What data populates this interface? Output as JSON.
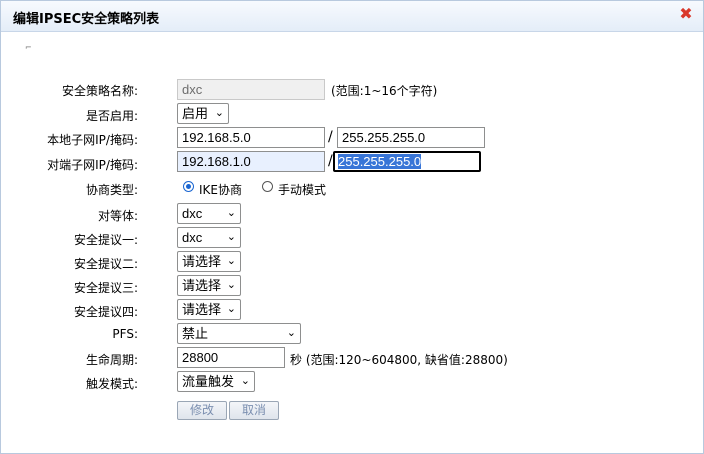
{
  "dialog": {
    "title": "编辑IPSEC安全策略列表",
    "close_glyph": "✖",
    "marker_glyph": "⌐"
  },
  "form": {
    "policy_name": {
      "label": "安全策略名称:",
      "value": "dxc",
      "hint": "(范围:1~16个字符)"
    },
    "enabled": {
      "label": "是否启用:",
      "value": "启用"
    },
    "local_subnet": {
      "label": "本地子网IP/掩码:",
      "ip": "192.168.5.0",
      "mask": "255.255.255.0",
      "separator": "/"
    },
    "remote_subnet": {
      "label": "对端子网IP/掩码:",
      "ip": "192.168.1.0",
      "mask": "255.255.255.0",
      "separator": "/"
    },
    "negotiation_type": {
      "label": "协商类型:",
      "option_ike": "IKE协商",
      "option_manual": "手动模式",
      "selected": "IKE协商"
    },
    "peer": {
      "label": "对等体:",
      "value": "dxc"
    },
    "proposal1": {
      "label": "安全提议一:",
      "value": "dxc"
    },
    "proposal2": {
      "label": "安全提议二:",
      "value": "请选择"
    },
    "proposal3": {
      "label": "安全提议三:",
      "value": "请选择"
    },
    "proposal4": {
      "label": "安全提议四:",
      "value": "请选择"
    },
    "pfs": {
      "label": "PFS:",
      "value": "禁止"
    },
    "lifetime": {
      "label": "生命周期:",
      "value": "28800",
      "hint": "秒 (范围:120~604800, 缺省值:28800)"
    },
    "trigger_mode": {
      "label": "触发模式:",
      "value": "流量触发"
    }
  },
  "buttons": {
    "modify": "修改",
    "cancel": "取消"
  },
  "colors": {
    "titlebar": "#e4edf8",
    "close": "#d9382a",
    "radio_selected": "#1a66d1",
    "selection": "#3875d7"
  }
}
